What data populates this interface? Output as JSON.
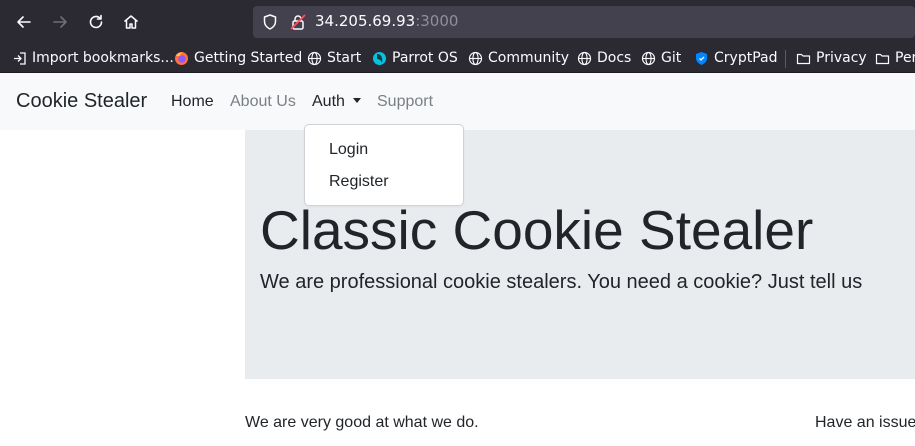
{
  "browser": {
    "url_host": "34.205.69.93",
    "url_port": ":3000",
    "bookmarks": [
      {
        "label": "Import bookmarks...",
        "icon": "import-icon"
      },
      {
        "label": "Getting Started",
        "icon": "firefox-icon"
      },
      {
        "label": "Start",
        "icon": "globe-icon"
      },
      {
        "label": "Parrot OS",
        "icon": "parrot-icon"
      },
      {
        "label": "Community",
        "icon": "globe-icon"
      },
      {
        "label": "Docs",
        "icon": "globe-icon"
      },
      {
        "label": "Git",
        "icon": "globe-icon"
      },
      {
        "label": "CryptPad",
        "icon": "cryptpad-icon"
      },
      {
        "label": "Privacy",
        "icon": "folder-icon"
      },
      {
        "label": "Per",
        "icon": "folder-icon"
      }
    ]
  },
  "site": {
    "brand": "Cookie Stealer",
    "nav": {
      "home": "Home",
      "about": "About Us",
      "auth": "Auth",
      "support": "Support"
    },
    "dropdown": {
      "login": "Login",
      "register": "Register"
    },
    "jumbotron": {
      "title": "Classic Cookie Stealer",
      "lead": "We are professional cookie stealers. You need a cookie? Just tell us"
    },
    "columns": {
      "left": "We are very good at what we do.",
      "right": "Have an issue"
    }
  },
  "colors": {
    "browser_bg": "#2b2a33",
    "urlbar_bg": "#42414d",
    "navbar_bg": "#f8f9fa",
    "jumbotron_bg": "#e9ecef",
    "text": "#212529",
    "muted_link": "#7a7f85"
  }
}
